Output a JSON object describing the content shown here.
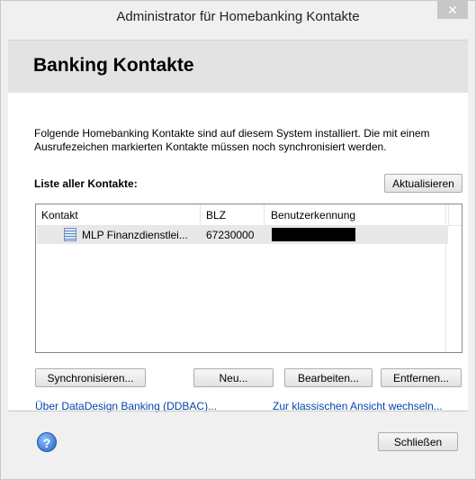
{
  "window": {
    "title": "Administrator für Homebanking Kontakte",
    "close_glyph": "✕"
  },
  "banner": {
    "heading": "Banking Kontakte"
  },
  "description": "Folgende Homebanking Kontakte sind auf diesem System installiert. Die mit einem Ausrufezeichen markierten Kontakte müssen noch synchronisiert werden.",
  "list": {
    "label": "Liste aller Kontakte:",
    "refresh_button": "Aktualisieren",
    "columns": [
      "Kontakt",
      "BLZ",
      "Benutzerkennung"
    ],
    "rows": [
      {
        "kontakt": "MLP Finanzdienstlei...",
        "blz": "67230000",
        "benutzerkennung": ""
      }
    ]
  },
  "buttons": {
    "sync": "Synchronisieren...",
    "new": "Neu...",
    "edit": "Bearbeiten...",
    "remove": "Entfernen...",
    "close": "Schließen"
  },
  "links": {
    "about": "Über DataDesign Banking (DDBAC)...",
    "classic_view": "Zur klassischen Ansicht wechseln..."
  },
  "help": {
    "glyph": "?"
  },
  "colors": {
    "link": "#0645ad",
    "banner_bg": "#e3e3e3",
    "selected_row": "#e8e8e8"
  }
}
